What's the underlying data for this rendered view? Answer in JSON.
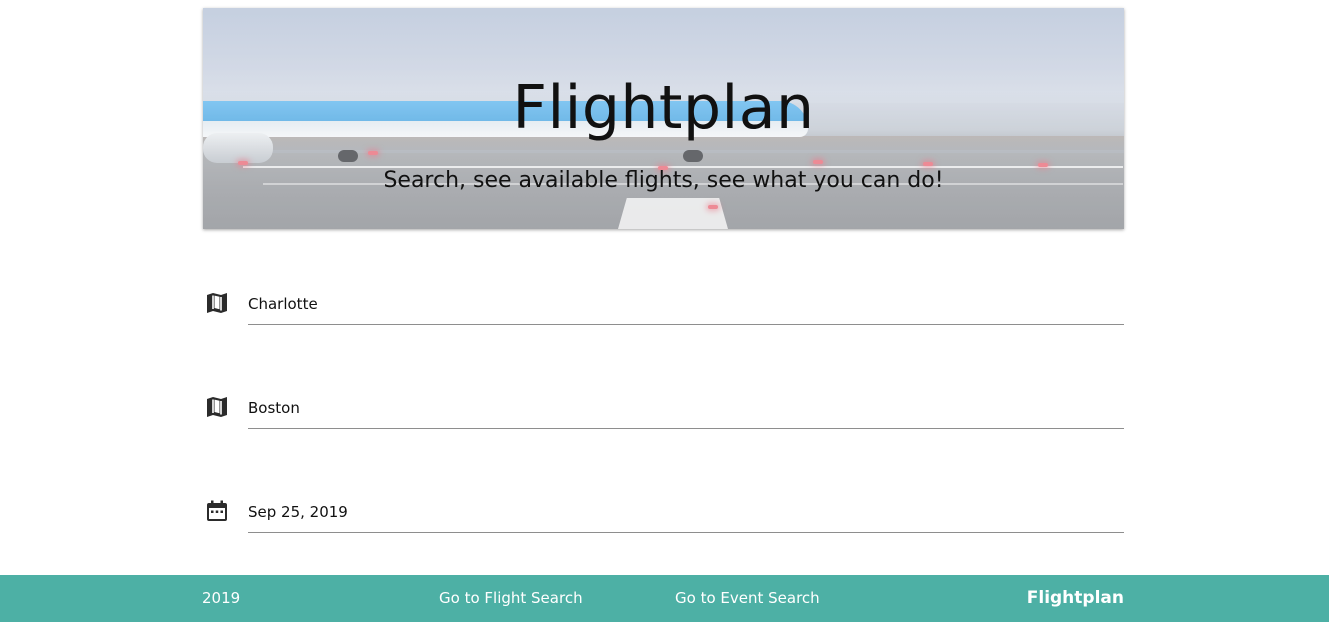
{
  "hero": {
    "title": "Flightplan",
    "subtitle": "Search, see available flights, see what you can do!"
  },
  "form": {
    "origin": {
      "value": "Charlotte",
      "icon": "map-icon"
    },
    "destination": {
      "value": "Boston",
      "icon": "map-icon"
    },
    "date": {
      "value": "Sep 25, 2019",
      "icon": "calendar-icon"
    }
  },
  "footer": {
    "year": "2019",
    "flight_search_link": "Go to Flight Search",
    "event_search_link": "Go to Event Search",
    "brand": "Flightplan",
    "background_color": "#4db0a5"
  }
}
